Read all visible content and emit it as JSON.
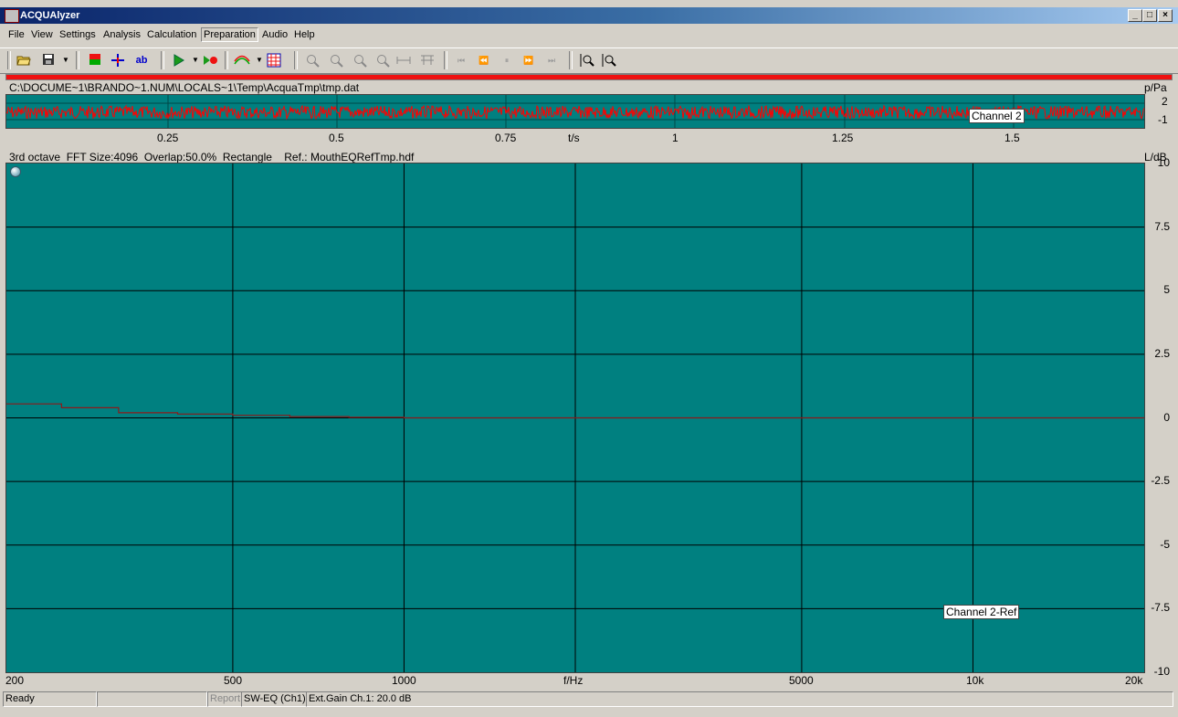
{
  "window": {
    "title": "ACQUAlyzer",
    "controls": [
      "_",
      "□",
      "×"
    ]
  },
  "menu": [
    "File",
    "View",
    "Settings",
    "Analysis",
    "Calculation",
    "Preparation",
    "Audio",
    "Help"
  ],
  "menu_active": "Preparation",
  "toolbar_icons": [
    "open-folder-icon",
    "save-icon",
    "record-stop-icon",
    "crosshair-icon",
    "label-ab-icon",
    "play-icon",
    "play-record-icon",
    "curve-icon",
    "grid-table-icon",
    "zoom-in-x-icon",
    "zoom-out-x-icon",
    "zoom-in-y-icon",
    "zoom-out-y-icon",
    "fit-horizontal-icon",
    "fit-vertical-icon",
    "first-icon",
    "previous-icon",
    "center-icon",
    "next-icon",
    "last-icon",
    "zoom-in-icon",
    "zoom-out-icon"
  ],
  "toolbar_glyphs": {
    "ab": "ab"
  },
  "time_plot": {
    "file_path": "C:\\DOCUME~1\\BRANDO~1.NUM\\LOCALS~1\\Temp\\AcquaTmp\\tmp.dat",
    "y_unit": "p/Pa",
    "y_ticks": [
      "2",
      "-1"
    ],
    "x_ticks": [
      "0.25",
      "0.5",
      "0.75",
      "1",
      "1.25",
      "1.5"
    ],
    "x_unit": "t/s",
    "channel_label": "Channel 2",
    "colors": {
      "background": "#008080",
      "signal": "#ff0000"
    }
  },
  "freq_plot": {
    "info": "3rd octave  FFT Size:4096  Overlap:50.0%  Rectangle    Ref.: MouthEQRefTmp.hdf",
    "y_unit": "L/dB",
    "y_ticks": [
      "10",
      "7.5",
      "5",
      "2.5",
      "0",
      "-2.5",
      "-5",
      "-7.5",
      "-10"
    ],
    "x_ticks": [
      "200",
      "500",
      "1000",
      "f/Hz",
      "5000",
      "10k",
      "20k"
    ],
    "channel_label": "Channel 2-Ref",
    "colors": {
      "background": "#008080",
      "curve": "#8b1a1a",
      "grid": "#000000"
    }
  },
  "chart_data": {
    "type": "line",
    "title": "",
    "xlabel": "f/Hz",
    "ylabel": "L/dB",
    "xscale": "log",
    "xlim": [
      200,
      20000
    ],
    "ylim": [
      -10,
      10
    ],
    "series": [
      {
        "name": "Channel 2-Ref",
        "x": [
          200,
          250,
          315,
          400,
          500,
          630,
          800,
          1000,
          2000,
          4000,
          8000,
          12500,
          16000,
          20000
        ],
        "y": [
          0.55,
          0.4,
          0.2,
          0.15,
          0.1,
          0.05,
          0.02,
          0.0,
          0.0,
          0.0,
          0.0,
          0.0,
          0.0,
          0.0
        ]
      }
    ]
  },
  "status": {
    "ready": "Ready",
    "blank": "",
    "report": "Report",
    "mode": "SW-EQ (Ch1)",
    "gain": "Ext.Gain Ch.1: 20.0 dB"
  }
}
